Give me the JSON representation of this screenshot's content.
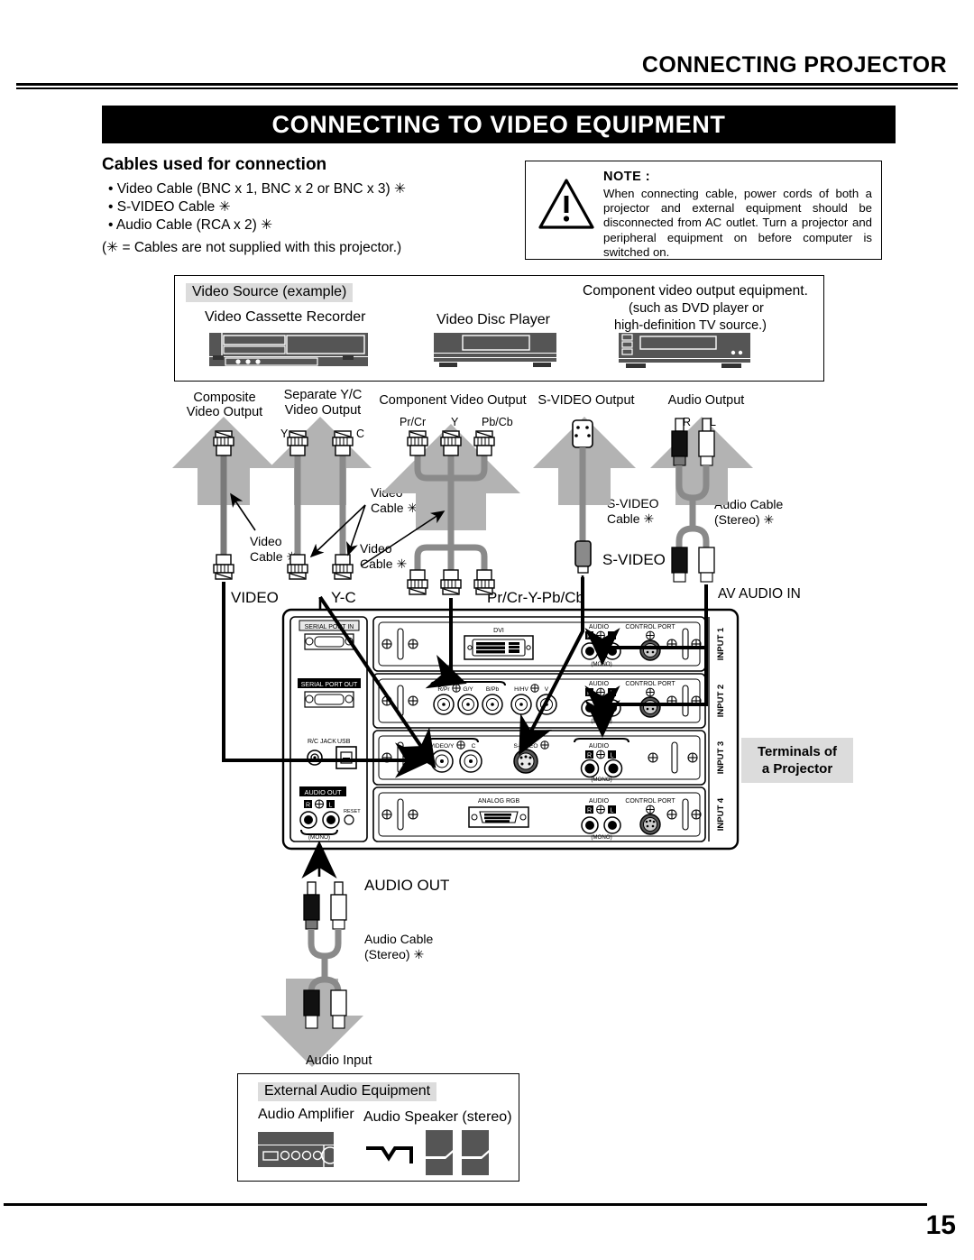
{
  "header": {
    "running_head": "CONNECTING PROJECTOR",
    "title": "CONNECTING TO VIDEO EQUIPMENT"
  },
  "cables_section": {
    "heading": "Cables used for connection",
    "items": [
      "• Video Cable (BNC x 1, BNC x 2 or BNC x 3) ✳",
      "• S-VIDEO Cable ✳",
      "• Audio Cable (RCA x 2) ✳"
    ],
    "footnote": "(✳ = Cables are not supplied with this projector.)"
  },
  "note": {
    "title": "NOTE  :",
    "body": "When connecting cable, power cords of both a projector and external equipment should be disconnected from AC outlet.  Turn a projector and peripheral equipment on before computer is switched on.",
    "icon": "warning-triangle-icon"
  },
  "video_source_box": {
    "tag": "Video Source (example)",
    "devices": [
      {
        "name": "Video Cassette Recorder"
      },
      {
        "name": "Video Disc Player"
      }
    ],
    "component_caption": [
      "Component video output equipment.",
      "(such as DVD player or",
      "high-definition TV source.)"
    ]
  },
  "outputs": [
    {
      "label_lines": [
        "Composite",
        "Video Output"
      ],
      "pins": []
    },
    {
      "label_lines": [
        "Separate Y/C",
        "Video Output"
      ],
      "pins": [
        "Y",
        "C"
      ]
    },
    {
      "label_lines": [
        "Component Video Output"
      ],
      "pins": [
        "Pr/Cr",
        "Y",
        "Pb/Cb"
      ]
    },
    {
      "label_lines": [
        "S-VIDEO Output"
      ],
      "pins": []
    },
    {
      "label_lines": [
        "Audio Output"
      ],
      "pins": [
        "R",
        "L"
      ]
    }
  ],
  "cable_labels": {
    "video_cable_1": [
      "Video",
      "Cable ✳"
    ],
    "video_cable_2": [
      "Video",
      "Cable ✳"
    ],
    "video_cable_3": [
      "Video",
      "Cable ✳"
    ],
    "video_cable_4": [
      "Video",
      "Cable ✳"
    ],
    "svideo_cable": [
      "S-VIDEO",
      "Cable ✳"
    ],
    "audio_cable_top": [
      "Audio Cable",
      "(Stereo) ✳"
    ],
    "audio_cable_bottom": [
      "Audio Cable",
      "(Stereo) ✳"
    ],
    "svideo_plug": "S-VIDEO"
  },
  "terminal_group_labels": {
    "video": "VIDEO",
    "yc": "Y-C",
    "component": "Pr/Cr-Y-Pb/Cb",
    "av_audio_in": "AV AUDIO IN",
    "audio_out": "AUDIO OUT"
  },
  "terminals_callout": {
    "line1": "Terminals of",
    "line2": "a Projector"
  },
  "projector_panel": {
    "left_column": {
      "serial_port_in": "SERIAL PORT IN",
      "serial_port_out": "SERIAL PORT OUT",
      "rc_jack": "R/C JACK",
      "usb": "USB",
      "audio_out": "AUDIO OUT",
      "audio_r": "R",
      "audio_l": "L",
      "reset": "RESET",
      "mono": "(MONO)"
    },
    "inputs": [
      {
        "name": "INPUT 1",
        "connector_label": "DVI",
        "audio_label": "AUDIO",
        "control_port_label": "CONTROL PORT",
        "audio_r": "R",
        "audio_l": "L",
        "mono": "(MONO)",
        "has_control_port": true
      },
      {
        "name": "INPUT 2",
        "bnc_labels": [
          "R/Pr",
          "G/Y",
          "B/Pb",
          "H/HV",
          "V"
        ],
        "audio_label": "AUDIO",
        "control_port_label": "CONTROL PORT",
        "audio_r": "R",
        "audio_l": "L",
        "mono": "(MONO)",
        "has_control_port": true
      },
      {
        "name": "INPUT 3",
        "video_labels": [
          "VIDEO/Y",
          "C"
        ],
        "svideo_label": "S-VIDEO",
        "audio_label": "AUDIO",
        "audio_r": "R",
        "audio_l": "L",
        "mono": "(MONO)",
        "has_control_port": false
      },
      {
        "name": "INPUT 4",
        "connector_label": "ANALOG RGB",
        "audio_label": "AUDIO",
        "control_port_label": "CONTROL PORT",
        "audio_r": "R",
        "audio_l": "L",
        "mono": "(MONO)",
        "has_control_port": true
      }
    ]
  },
  "audio_out_section": {
    "title": "AUDIO OUT",
    "cable": [
      "Audio Cable",
      "(Stereo) ✳"
    ],
    "audio_input_label": "Audio Input"
  },
  "external_audio_box": {
    "tag": "External Audio Equipment",
    "amplifier": "Audio Amplifier",
    "speaker": "Audio Speaker (stereo)"
  },
  "footer": {
    "page_number": "15"
  },
  "colors": {
    "banner_bg": "#000000",
    "tag_gray": "#dcdcdc",
    "arrow_gray": "#b3b3b3",
    "device_gray": "#555555",
    "cable_gray": "#7a7a7a"
  }
}
